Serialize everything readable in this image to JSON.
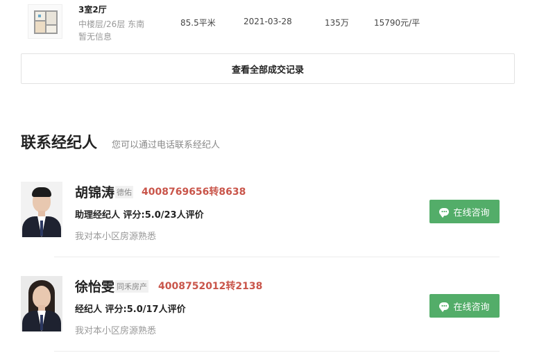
{
  "deal": {
    "layout": "3室2厅",
    "floor_orientation": "中楼层/26层 东南",
    "extra_info": "暂无信息",
    "area": "85.5平米",
    "date": "2021-03-28",
    "total_price": "135万",
    "unit_price": "15790元/平"
  },
  "view_all_label": "查看全部成交记录",
  "contact_section": {
    "title": "联系经纪人",
    "subtitle": "您可以通过电话联系经纪人"
  },
  "agents": [
    {
      "name": "胡锦涛",
      "company": "德佑",
      "phone": "4008769656转8638",
      "role_rating": "助理经纪人  评分:5.0/23人评价",
      "description": "我对本小区房源熟悉",
      "consult_label": "在线咨询"
    },
    {
      "name": "徐怡雯",
      "company": "同禾房产",
      "phone": "4008752012转2138",
      "role_rating": "经纪人  评分:5.0/17人评价",
      "description": "我对本小区房源熟悉",
      "consult_label": "在线咨询"
    }
  ],
  "colors": {
    "phone": "#c9554a",
    "consult_button": "#53ad69"
  },
  "icons": {
    "consult": "chat-bubble-icon",
    "floorplan": "floorplan-thumbnail"
  }
}
